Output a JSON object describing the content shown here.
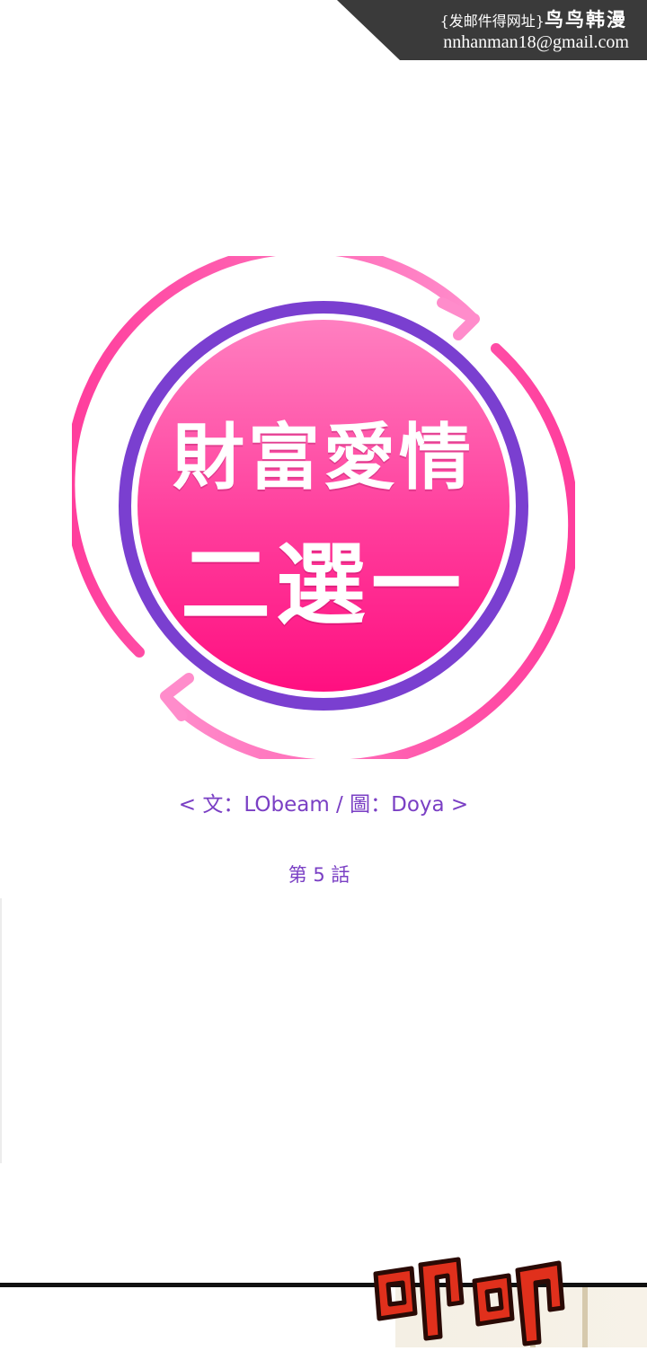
{
  "watermark": {
    "line1_prefix": "{发邮件得网址}",
    "line1_brand": "鸟鸟韩漫",
    "line2": "nnhanman18@gmail.com"
  },
  "title": {
    "line1": "財富愛情",
    "line2": "二選一"
  },
  "credits": {
    "open": "<",
    "writer_label": "文",
    "separator": "：",
    "writer": "LObeam",
    "divider": "/",
    "artist_label": "圖",
    "artist": "Doya",
    "close": ">"
  },
  "episode": "第 5 話",
  "sfx": "叩叩",
  "colors": {
    "title_fill": "#ff1f8e",
    "ring_purple": "#7a3fd0",
    "ring_pink": "#ff4fa8",
    "credit_text": "#7a3fc4",
    "watermark_bg": "#3a3a3a"
  }
}
